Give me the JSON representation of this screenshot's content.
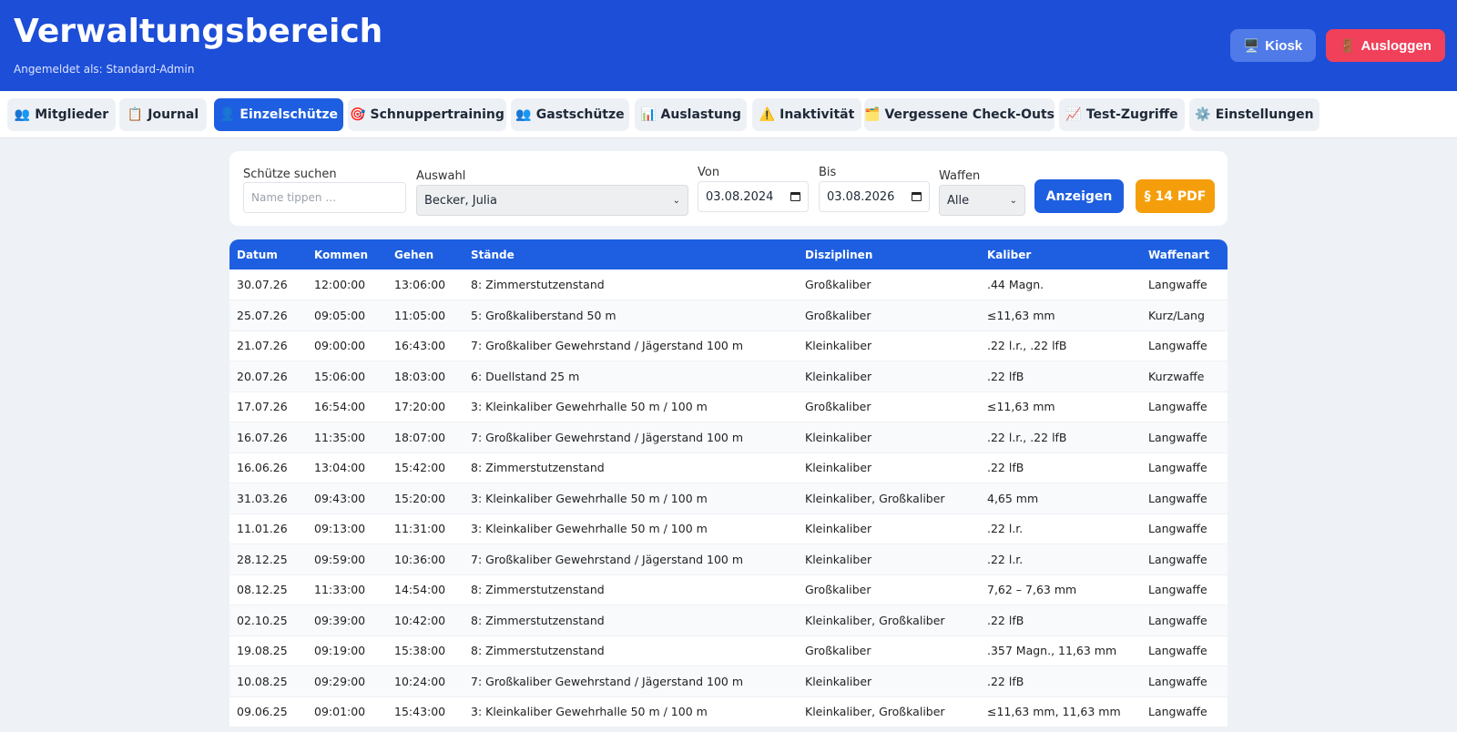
{
  "header": {
    "title": "Verwaltungsbereich",
    "subtitle": "Angemeldet als: Standard-Admin",
    "kiosk_icon": "🖥️",
    "kiosk_label": "Kiosk",
    "logout_icon": "🚪",
    "logout_label": "Ausloggen",
    "bg_color": "#1d4ed8"
  },
  "tabs": [
    {
      "icon": "👥",
      "label": "Mitglieder"
    },
    {
      "icon": "📋",
      "label": "Journal"
    },
    {
      "icon": "👤",
      "label": "Einzelschütze",
      "active": true
    },
    {
      "icon": "🎯",
      "label": "Schnuppertraining"
    },
    {
      "icon": "👥",
      "label": "Gastschütze"
    },
    {
      "icon": "📊",
      "label": "Auslastung"
    },
    {
      "icon": "⚠️",
      "label": "Inaktivität"
    },
    {
      "icon": "🗂️",
      "label": "Vergessene Check-Outs"
    },
    {
      "icon": "📈",
      "label": "Test-Zugriffe"
    },
    {
      "icon": "⚙️",
      "label": "Einstellungen"
    }
  ],
  "filter": {
    "search_label": "Schütze suchen",
    "search_placeholder": "Name tippen …",
    "select_label": "Auswahl",
    "select_value": "Becker, Julia",
    "from_label": "Von",
    "from_value": "03.08.2024",
    "to_label": "Bis",
    "to_value": "03.08.2026",
    "weapons_label": "Waffen",
    "weapons_value": "Alle",
    "show_button": "Anzeigen",
    "pdf_button": "§ 14 PDF"
  },
  "table": {
    "columns": [
      "Datum",
      "Kommen",
      "Gehen",
      "Stände",
      "Disziplinen",
      "Kaliber",
      "Waffenart"
    ],
    "rows": [
      [
        "30.07.26",
        "12:00:00",
        "13:06:00",
        "8: Zimmerstutzenstand",
        "Großkaliber",
        ".44 Magn.",
        "Langwaffe"
      ],
      [
        "25.07.26",
        "09:05:00",
        "11:05:00",
        "5: Großkaliberstand 50 m",
        "Großkaliber",
        "≤11,63 mm",
        "Kurz/Lang"
      ],
      [
        "21.07.26",
        "09:00:00",
        "16:43:00",
        "7: Großkaliber Gewehrstand / Jägerstand 100 m",
        "Kleinkaliber",
        ".22 l.r., .22 lfB",
        "Langwaffe"
      ],
      [
        "20.07.26",
        "15:06:00",
        "18:03:00",
        "6: Duellstand 25 m",
        "Kleinkaliber",
        ".22 lfB",
        "Kurzwaffe"
      ],
      [
        "17.07.26",
        "16:54:00",
        "17:20:00",
        "3: Kleinkaliber Gewehrhalle 50 m / 100 m",
        "Großkaliber",
        "≤11,63 mm",
        "Langwaffe"
      ],
      [
        "16.07.26",
        "11:35:00",
        "18:07:00",
        "7: Großkaliber Gewehrstand / Jägerstand 100 m",
        "Kleinkaliber",
        ".22 l.r., .22 lfB",
        "Langwaffe"
      ],
      [
        "16.06.26",
        "13:04:00",
        "15:42:00",
        "8: Zimmerstutzenstand",
        "Kleinkaliber",
        ".22 lfB",
        "Langwaffe"
      ],
      [
        "31.03.26",
        "09:43:00",
        "15:20:00",
        "3: Kleinkaliber Gewehrhalle 50 m / 100 m",
        "Kleinkaliber, Großkaliber",
        "4,65 mm",
        "Langwaffe"
      ],
      [
        "11.01.26",
        "09:13:00",
        "11:31:00",
        "3: Kleinkaliber Gewehrhalle 50 m / 100 m",
        "Kleinkaliber",
        ".22 l.r.",
        "Langwaffe"
      ],
      [
        "28.12.25",
        "09:59:00",
        "10:36:00",
        "7: Großkaliber Gewehrstand / Jägerstand 100 m",
        "Kleinkaliber",
        ".22 l.r.",
        "Langwaffe"
      ],
      [
        "08.12.25",
        "11:33:00",
        "14:54:00",
        "8: Zimmerstutzenstand",
        "Großkaliber",
        "7,62 – 7,63 mm",
        "Langwaffe"
      ],
      [
        "02.10.25",
        "09:39:00",
        "10:42:00",
        "8: Zimmerstutzenstand",
        "Kleinkaliber, Großkaliber",
        ".22 lfB",
        "Langwaffe"
      ],
      [
        "19.08.25",
        "09:19:00",
        "15:38:00",
        "8: Zimmerstutzenstand",
        "Großkaliber",
        ".357 Magn., 11,63 mm",
        "Langwaffe"
      ],
      [
        "10.08.25",
        "09:29:00",
        "10:24:00",
        "7: Großkaliber Gewehrstand / Jägerstand 100 m",
        "Kleinkaliber",
        ".22 lfB",
        "Langwaffe"
      ],
      [
        "09.06.25",
        "09:01:00",
        "15:43:00",
        "3: Kleinkaliber Gewehrhalle 50 m / 100 m",
        "Kleinkaliber, Großkaliber",
        "≤11,63 mm, 11,63 mm",
        "Langwaffe"
      ]
    ]
  }
}
